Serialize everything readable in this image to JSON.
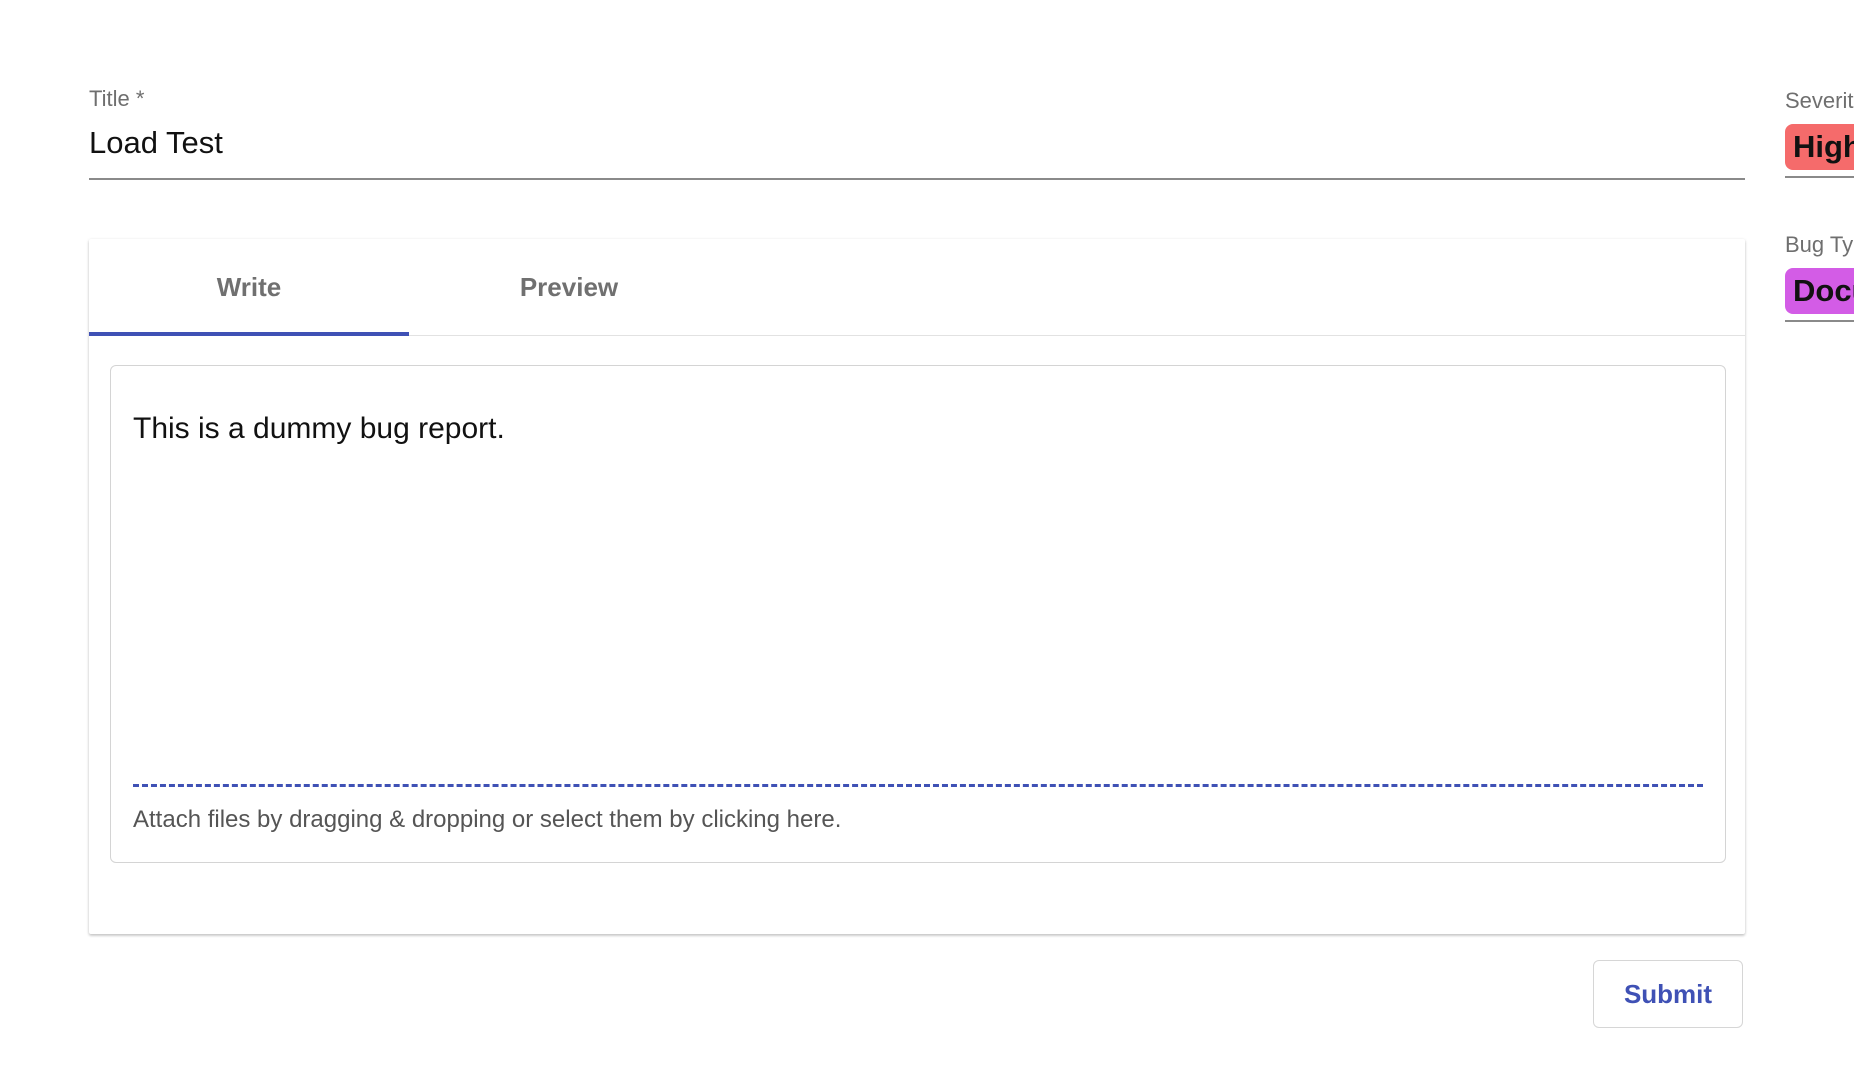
{
  "title_field": {
    "label": "Title *",
    "value": "Load Test"
  },
  "editor": {
    "tabs": [
      {
        "label": "Write",
        "active": true
      },
      {
        "label": "Preview",
        "active": false
      }
    ],
    "content": "This is a dummy bug report.",
    "dropzone_text": "Attach files by dragging & dropping or select them by clicking here."
  },
  "submit": {
    "label": "Submit"
  },
  "severity": {
    "label": "Severit",
    "value": "High",
    "color": "#f56b6b"
  },
  "bug_type": {
    "label": "Bug Ty",
    "value": "Docu",
    "color": "#d35ce6"
  },
  "colors": {
    "accent": "#3f51b5"
  }
}
